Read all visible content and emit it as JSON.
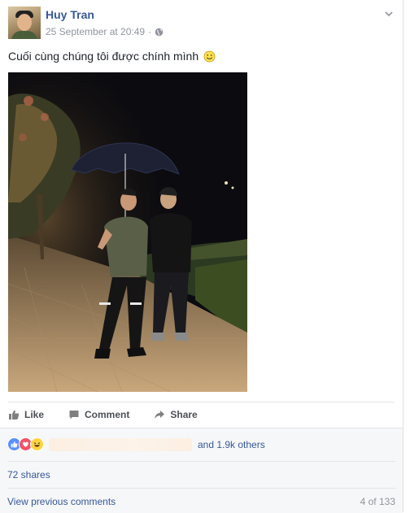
{
  "post": {
    "author": "Huy Tran",
    "timestamp": "25 September at 20:49",
    "separator": "·",
    "caption": "Cuối cùng chúng tôi được chính mình",
    "privacy_icon": "globe-icon",
    "options_icon": "chevron-down-icon"
  },
  "actions": {
    "like": "Like",
    "comment": "Comment",
    "share": "Share"
  },
  "reactions": {
    "icons": [
      "like-icon",
      "love-icon",
      "haha-icon"
    ],
    "others": "and 1.9k others"
  },
  "shares": "72 shares",
  "comments": {
    "view_previous": "View previous comments",
    "count": "4 of 133"
  },
  "colors": {
    "link": "#365899",
    "muted": "#90949c",
    "like_blue": "#5890ff",
    "love_red": "#f25268",
    "haha_yellow": "#fcd440"
  }
}
